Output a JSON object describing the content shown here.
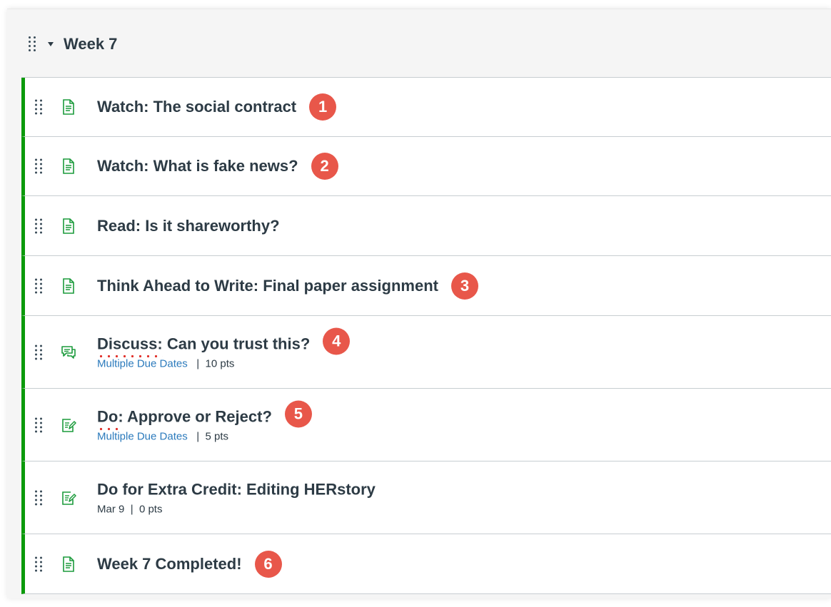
{
  "module": {
    "title": "Week 7",
    "items": [
      {
        "title": "Watch: The social contract",
        "icon": "page-icon",
        "badge": "1"
      },
      {
        "title": "Watch: What is fake news?",
        "icon": "page-icon",
        "badge": "2"
      },
      {
        "title": "Read: Is it shareworthy?",
        "icon": "page-icon"
      },
      {
        "title": "Think Ahead to Write: Final paper assignment",
        "icon": "page-icon",
        "badge": "3"
      },
      {
        "title_underlined": "Discuss:",
        "title_rest": " Can you trust this?",
        "icon": "discussion-icon",
        "badge": "4",
        "due": "Multiple Due Dates",
        "separator": "|",
        "points": "10 pts"
      },
      {
        "title_underlined": "Do:",
        "title_rest": " Approve or Reject?",
        "icon": "assignment-icon",
        "badge": "5",
        "due": "Multiple Due Dates",
        "separator": "|",
        "points": "5 pts"
      },
      {
        "title": "Do for Extra Credit: Editing HERstory",
        "icon": "assignment-icon",
        "due": "Mar 9",
        "separator": "|",
        "points": "0 pts"
      },
      {
        "title": "Week 7 Completed!",
        "icon": "page-icon",
        "badge": "6"
      }
    ]
  },
  "colors": {
    "published_bar": "#0b9a0b",
    "badge": "#e8574a",
    "link": "#2b7abc",
    "icon": "#1c9b3c"
  }
}
